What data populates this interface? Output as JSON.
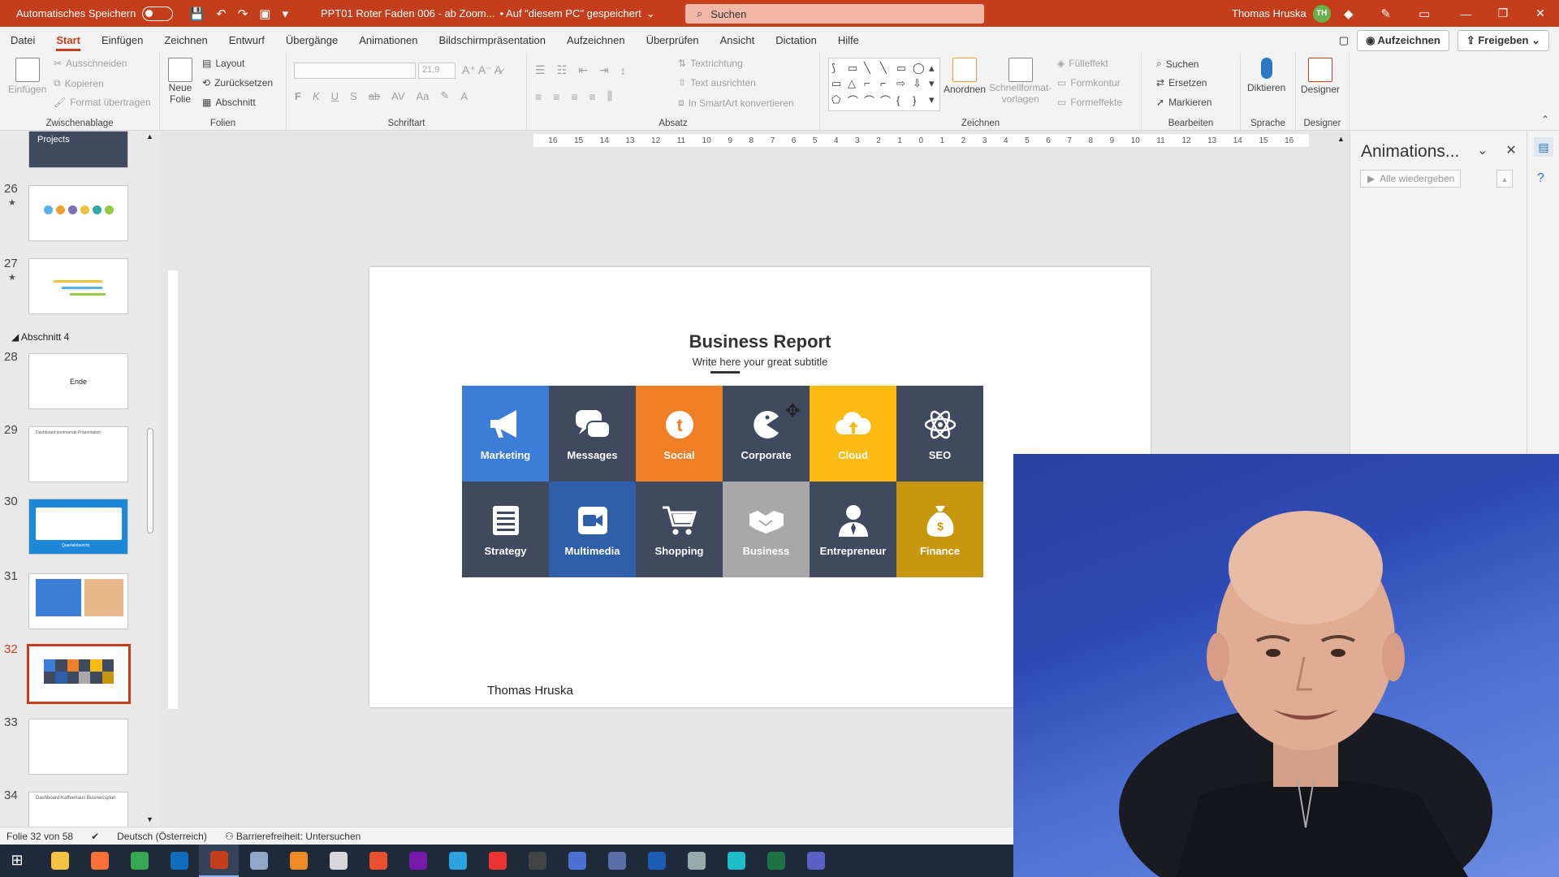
{
  "titlebar": {
    "autosave_label": "Automatisches Speichern",
    "doc_title": "PPT01 Roter Faden 006 - ab Zoom...",
    "save_location": "• Auf \"diesem PC\" gespeichert",
    "search_placeholder": "Suchen",
    "user_name": "Thomas Hruska",
    "user_initials": "TH",
    "accent": "#c43e1c"
  },
  "tabs": [
    {
      "label": "Datei"
    },
    {
      "label": "Start"
    },
    {
      "label": "Einfügen"
    },
    {
      "label": "Zeichnen"
    },
    {
      "label": "Entwurf"
    },
    {
      "label": "Übergänge"
    },
    {
      "label": "Animationen"
    },
    {
      "label": "Bildschirmpräsentation"
    },
    {
      "label": "Aufzeichnen"
    },
    {
      "label": "Überprüfen"
    },
    {
      "label": "Ansicht"
    },
    {
      "label": "Dictation"
    },
    {
      "label": "Hilfe"
    }
  ],
  "tabs_right": {
    "record": "Aufzeichnen",
    "share": "Freigeben"
  },
  "ribbon": {
    "clipboard": {
      "paste": "Einfügen",
      "cut": "Ausschneiden",
      "copy": "Kopieren",
      "format_painter": "Format übertragen",
      "label": "Zwischenablage"
    },
    "slides": {
      "new_slide_1": "Neue",
      "new_slide_2": "Folie",
      "layout": "Layout",
      "reset": "Zurücksetzen",
      "section": "Abschnitt",
      "label": "Folien"
    },
    "font": {
      "label": "Schriftart",
      "size": "21,9",
      "bold": "F",
      "italic": "K",
      "underline": "U",
      "shadow": "S",
      "strike": "ab",
      "spacing": "AV",
      "case": "Aa"
    },
    "paragraph": {
      "label": "Absatz",
      "text_direction": "Textrichtung",
      "align_text": "Text ausrichten",
      "smartart": "In SmartArt konvertieren"
    },
    "drawing": {
      "label": "Zeichnen",
      "arrange": "Anordnen",
      "quick_styles_1": "Schnellformat-",
      "quick_styles_2": "vorlagen",
      "fill": "Fülleffekt",
      "outline": "Formkontur",
      "effects": "Formeffekte"
    },
    "editing": {
      "label": "Bearbeiten",
      "find": "Suchen",
      "replace": "Ersetzen",
      "select": "Markieren"
    },
    "voice": {
      "label": "Sprache",
      "dictate": "Diktieren"
    },
    "designer": {
      "label": "Designer",
      "button": "Designer"
    }
  },
  "thumbnails": {
    "top_partial_text": "Projects",
    "section_label": "Abschnitt 4",
    "items": [
      {
        "num": "26",
        "star": "★"
      },
      {
        "num": "27",
        "star": "★"
      },
      {
        "num": "28",
        "text": "Ende"
      },
      {
        "num": "29",
        "text": "Dashboard kommende Präsentation"
      },
      {
        "num": "30",
        "text": "Quartalsbericht"
      },
      {
        "num": "31"
      },
      {
        "num": "32"
      },
      {
        "num": "33"
      },
      {
        "num": "34",
        "text": "Dashboard Kaffeehaus Businessplan"
      }
    ]
  },
  "ruler_ticks": [
    "16",
    "15",
    "14",
    "13",
    "12",
    "11",
    "10",
    "9",
    "8",
    "7",
    "6",
    "5",
    "4",
    "3",
    "2",
    "1",
    "0",
    "1",
    "2",
    "3",
    "4",
    "5",
    "6",
    "7",
    "8",
    "9",
    "10",
    "11",
    "12",
    "13",
    "14",
    "15",
    "16"
  ],
  "slide": {
    "title": "Business Report",
    "subtitle": "Write here your great subtitle",
    "author": "Thomas Hruska",
    "tiles": [
      {
        "label": "Marketing",
        "color": "#3b7dd8",
        "icon": "megaphone-icon"
      },
      {
        "label": "Messages",
        "color": "#3f4a5e",
        "icon": "chat-bubbles-icon"
      },
      {
        "label": "Social",
        "color": "#f07e26",
        "icon": "twitter-icon"
      },
      {
        "label": "Corporate",
        "color": "#3f4a5e",
        "icon": "pacman-icon"
      },
      {
        "label": "Cloud",
        "color": "#fbbb12",
        "icon": "cloud-upload-icon"
      },
      {
        "label": "SEO",
        "color": "#3f4a5e",
        "icon": "atom-icon"
      },
      {
        "label": "Strategy",
        "color": "#3f4a5e",
        "icon": "list-icon"
      },
      {
        "label": "Multimedia",
        "color": "#2f5fa8",
        "icon": "video-camera-icon"
      },
      {
        "label": "Shopping",
        "color": "#3f4a5e",
        "icon": "cart-icon"
      },
      {
        "label": "Business",
        "color": "#a8a8a8",
        "icon": "handshake-icon"
      },
      {
        "label": "Entrepreneur",
        "color": "#3f4a5e",
        "icon": "person-icon"
      },
      {
        "label": "Finance",
        "color": "#c8960c",
        "icon": "money-bag-icon"
      }
    ]
  },
  "anim_pane": {
    "title": "Animations...",
    "play_all": "Alle wiedergeben"
  },
  "statusbar": {
    "slide_info": "Folie 32 von 58",
    "language": "Deutsch (Österreich)",
    "accessibility": "Barrierefreiheit: Untersuchen"
  },
  "taskbar": [
    {
      "name": "windows-start-icon",
      "color": "#ffffff"
    },
    {
      "name": "file-explorer-icon",
      "color": "#f5c242"
    },
    {
      "name": "firefox-icon",
      "color": "#ff7139"
    },
    {
      "name": "chrome-icon",
      "color": "#34a853"
    },
    {
      "name": "outlook-icon",
      "color": "#0f6cbd"
    },
    {
      "name": "powerpoint-icon",
      "color": "#c43e1c"
    },
    {
      "name": "app-icon",
      "color": "#8fa8c8"
    },
    {
      "name": "vlc-icon",
      "color": "#f08a24"
    },
    {
      "name": "app-icon",
      "color": "#d8d8d8"
    },
    {
      "name": "app-icon",
      "color": "#e9502e"
    },
    {
      "name": "onenote-icon",
      "color": "#7719aa"
    },
    {
      "name": "telegram-icon",
      "color": "#2aa3df"
    },
    {
      "name": "app-icon",
      "color": "#e33"
    },
    {
      "name": "obs-icon",
      "color": "#444"
    },
    {
      "name": "app-icon",
      "color": "#4b6fd3"
    },
    {
      "name": "app-icon",
      "color": "#5a6ea8"
    },
    {
      "name": "word-icon",
      "color": "#1a5bb8"
    },
    {
      "name": "app-icon",
      "color": "#9aa"
    },
    {
      "name": "edge-icon",
      "color": "#1ebcc9"
    },
    {
      "name": "excel-icon",
      "color": "#1d7244"
    },
    {
      "name": "teams-icon",
      "color": "#5b5fc7"
    }
  ]
}
